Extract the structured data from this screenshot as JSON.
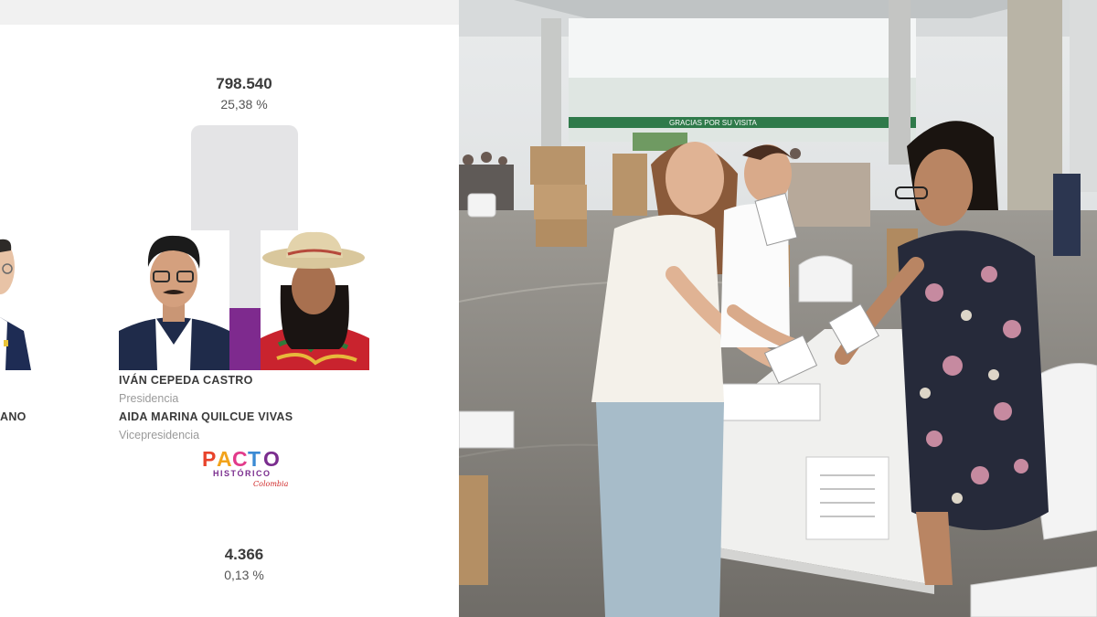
{
  "results": {
    "left_candidate": {
      "name_fragment": "ANO"
    },
    "main_candidate": {
      "votes": "798.540",
      "percent": "25,38 %",
      "bar_share": 0.2538,
      "president_name": "IVÁN CEPEDA CASTRO",
      "president_role": "Presidencia",
      "vice_name": "AIDA MARINA QUILCUE VIVAS",
      "vice_role": "Vicepresidencia",
      "party_logo": {
        "line1": "PACTO",
        "line2": "HISTÓRICO",
        "tag": "Colombia"
      }
    },
    "bottom_row": {
      "votes": "4.366",
      "percent": "0,13 %"
    },
    "colors": {
      "bar_fill": "#7e2a8e",
      "bar_track": "#e4e4e6",
      "text_dark": "#3a3a3a",
      "text_muted": "#9a9a9a"
    }
  },
  "photo": {
    "banner_text": "GRACIAS POR SU VISITA"
  }
}
